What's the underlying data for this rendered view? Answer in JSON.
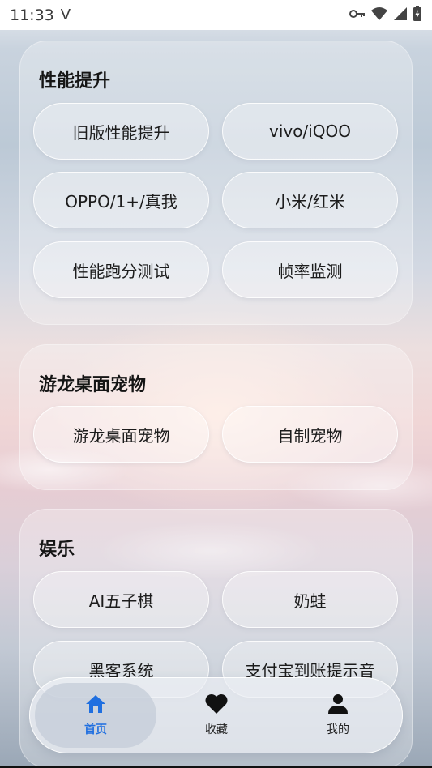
{
  "status_bar": {
    "time": "11:33",
    "carrier_glyph": "V",
    "icons": [
      "vpn-key-icon",
      "wifi-icon",
      "signal-icon",
      "battery-charging-icon"
    ]
  },
  "sections": {
    "performance": {
      "title": "性能提升",
      "buttons": [
        "旧版性能提升",
        "vivo/iQOO",
        "OPPO/1+/真我",
        "小米/红米",
        "性能跑分测试",
        "帧率监测"
      ]
    },
    "desktop_pet": {
      "title": "游龙桌面宠物",
      "buttons": [
        "游龙桌面宠物",
        "自制宠物"
      ]
    },
    "entertainment": {
      "title": "娱乐",
      "buttons": [
        "AI五子棋",
        "奶蛙",
        "黑客系统",
        "支付宝到账提示音"
      ]
    }
  },
  "bottom_nav": {
    "items": [
      {
        "label": "首页",
        "icon": "home-icon",
        "active": true
      },
      {
        "label": "收藏",
        "icon": "heart-icon",
        "active": false
      },
      {
        "label": "我的",
        "icon": "person-icon",
        "active": false
      }
    ]
  },
  "colors": {
    "accent": "#1f6fe0",
    "text": "#1c1c1c"
  }
}
